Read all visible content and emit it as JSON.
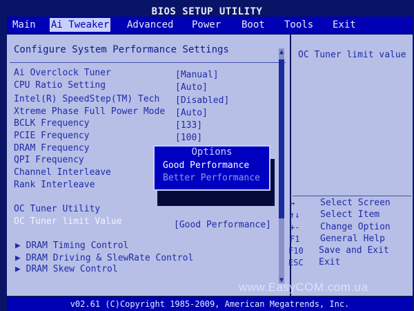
{
  "title": "BIOS SETUP UTILITY",
  "menu": {
    "items": [
      {
        "label": "Main",
        "active": false
      },
      {
        "label": "Ai Tweaker",
        "active": true
      },
      {
        "label": "Advanced",
        "active": false
      },
      {
        "label": "Power",
        "active": false
      },
      {
        "label": "Boot",
        "active": false
      },
      {
        "label": "Tools",
        "active": false
      },
      {
        "label": "Exit",
        "active": false
      }
    ]
  },
  "panel": {
    "heading": "Configure System Performance Settings",
    "settings": [
      {
        "label": "Ai Overclock Tuner",
        "value": "[Manual]"
      },
      {
        "label": "CPU Ratio Setting",
        "value": "[Auto]"
      },
      {
        "label": "Intel(R) SpeedStep(TM) Tech",
        "value": "[Disabled]"
      },
      {
        "label": "Xtreme Phase Full Power Mode",
        "value": "[Auto]"
      },
      {
        "label": "BCLK Frequency",
        "value": "[133]"
      },
      {
        "label": "PCIE Frequency",
        "value": "[100]"
      },
      {
        "label": "DRAM Frequency",
        "value": ""
      },
      {
        "label": "QPI Frequency",
        "value": ""
      },
      {
        "label": "Channel Interleave",
        "value": ""
      },
      {
        "label": "Rank Interleave",
        "value": ""
      },
      {
        "label": "OC Tuner Utility",
        "value": ""
      },
      {
        "label": "OC Tuner limit Value",
        "value": "[Good Performance]"
      }
    ],
    "submenus": [
      "▶ DRAM Timing Control",
      "▶ DRAM Driving & SlewRate Control",
      "▶ DRAM Skew Control"
    ]
  },
  "popup": {
    "title": "Options",
    "options": [
      "Good Performance",
      "Better Performance"
    ],
    "selected_index": 0
  },
  "help": {
    "text": "OC Tuner limit value",
    "keys": [
      {
        "key": "↔",
        "desc": "Select Screen"
      },
      {
        "key": "↑↓",
        "desc": "Select Item"
      },
      {
        "key": "+-",
        "desc": "Change Option"
      },
      {
        "key": "F1",
        "desc": "General Help"
      },
      {
        "key": "F10",
        "desc": "Save and Exit"
      },
      {
        "key": "ESC",
        "desc": "Exit"
      }
    ]
  },
  "footer": "v02.61 (C)Copyright 1985-2009, American Megatrends, Inc.",
  "watermark": "www.EasyCOM.com.ua"
}
